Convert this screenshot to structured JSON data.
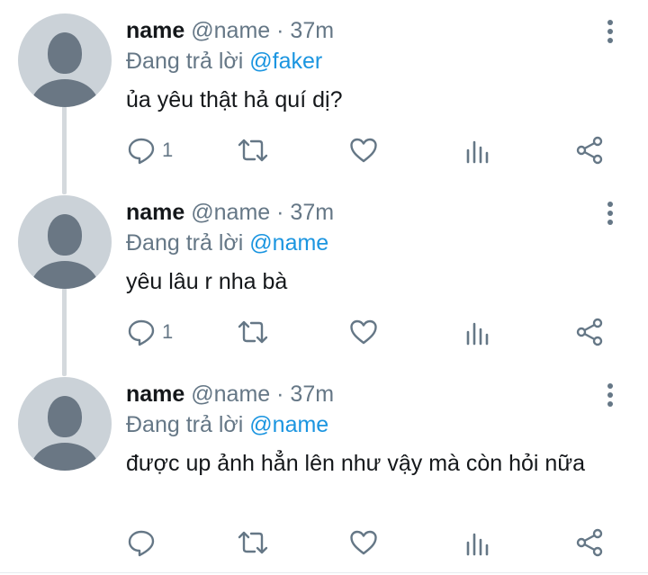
{
  "tweets": [
    {
      "name": "name",
      "handle": "@name",
      "separator": "·",
      "time": "37m",
      "replying_prefix": "Đang trả lời",
      "replying_to": "@faker",
      "text": "ủa yêu thật hả quí dị?",
      "reply_count": "1"
    },
    {
      "name": "name",
      "handle": "@name",
      "separator": "·",
      "time": "37m",
      "replying_prefix": "Đang trả lời",
      "replying_to": "@name",
      "text": "yêu lâu r nha bà",
      "reply_count": "1"
    },
    {
      "name": "name",
      "handle": "@name",
      "separator": "·",
      "time": "37m",
      "replying_prefix": "Đang trả lời",
      "replying_to": "@name",
      "text": "được up ảnh hẳn lên như vậy mà còn hỏi nữa",
      "reply_count": ""
    }
  ],
  "icons": {
    "reply": "reply-icon",
    "retweet": "retweet-icon",
    "like": "heart-icon",
    "analytics": "analytics-icon",
    "share": "share-icon",
    "more": "more-vertical-icon"
  },
  "colors": {
    "text": "#14171a",
    "secondary": "#657786",
    "mention": "#1b95e0",
    "thread_line": "#d4d9dd",
    "avatar_bg": "#cbd2d8",
    "avatar_fg": "#6a7784"
  }
}
